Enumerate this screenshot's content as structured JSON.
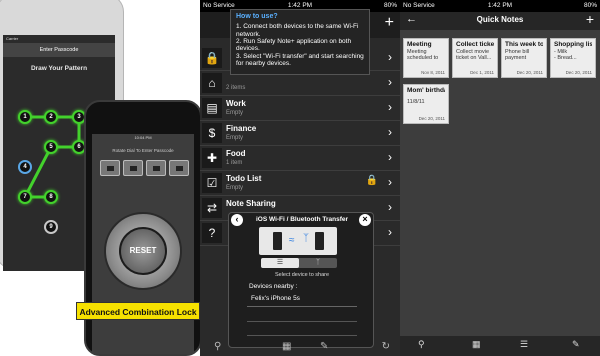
{
  "panel1": {
    "back_phone": {
      "carrier": "Carrier",
      "title": "Enter Passcode",
      "pattern_title": "Draw Your Pattern",
      "dots": [
        "1",
        "2",
        "3",
        "4",
        "5",
        "6",
        "7",
        "8",
        "9"
      ]
    },
    "front_phone": {
      "time": "10:04 PM",
      "subtitle": "Rotate Dial To Enter Passcode",
      "reset_label": "RESET"
    },
    "caption": "Advanced Combination Lock",
    "colors": {
      "pattern": "#43d12c",
      "caption_bg": "#f6e100"
    }
  },
  "panel2": {
    "status": {
      "carrier": "No Service",
      "time": "1:42 PM",
      "battery": "80%"
    },
    "howto": {
      "title": "How to use?",
      "steps": [
        "1. Connect both devices to the same Wi-Fi network.",
        "2. Run Safety Note+ application on both devices.",
        "3. Select \"Wi-Fi transfer\" and start searching for nearby devices."
      ]
    },
    "add_icon": "plus-icon",
    "categories": [
      {
        "title": "",
        "sub": "",
        "icon": "lock-icon"
      },
      {
        "title": "",
        "sub": "2 items",
        "icon": "home-icon"
      },
      {
        "title": "Work",
        "sub": "Empty",
        "icon": "briefcase-icon"
      },
      {
        "title": "Finance",
        "sub": "Empty",
        "icon": "dollar-icon"
      },
      {
        "title": "Food",
        "sub": "1 item",
        "icon": "fork-knife-icon"
      },
      {
        "title": "Todo List",
        "sub": "Empty",
        "icon": "checkbox-icon"
      },
      {
        "title": "Note Sharing",
        "sub": "",
        "icon": "transfer-icon"
      },
      {
        "title": "",
        "sub": "",
        "icon": "question-icon"
      }
    ],
    "dialog": {
      "title": "iOS Wi-Fi / Bluetooth Transfer",
      "select_text": "Select device to share",
      "nearby_label": "Devices nearby :",
      "device": "Felix's iPhone 5s"
    }
  },
  "panel3": {
    "status": {
      "carrier": "No Service",
      "time": "1:42 PM",
      "battery": "80%"
    },
    "title": "Quick Notes",
    "notes": [
      {
        "title": "Meeting",
        "body": "Meeting scheduled to",
        "date": "Nov 8, 2011"
      },
      {
        "title": "Collect ticket",
        "body": "Collect movie ticket on Vall...",
        "date": "Dec 1, 2011"
      },
      {
        "title": "This week todo",
        "body": "Phone bill payment",
        "date": "Dec 20, 2011"
      },
      {
        "title": "Shopping list",
        "body": "- Milk\n- Bread...",
        "date": "Dec 20, 2011"
      },
      {
        "title": "Mom' birthda...",
        "body": "11/8/11",
        "date": "Dec 20, 2011"
      }
    ]
  }
}
